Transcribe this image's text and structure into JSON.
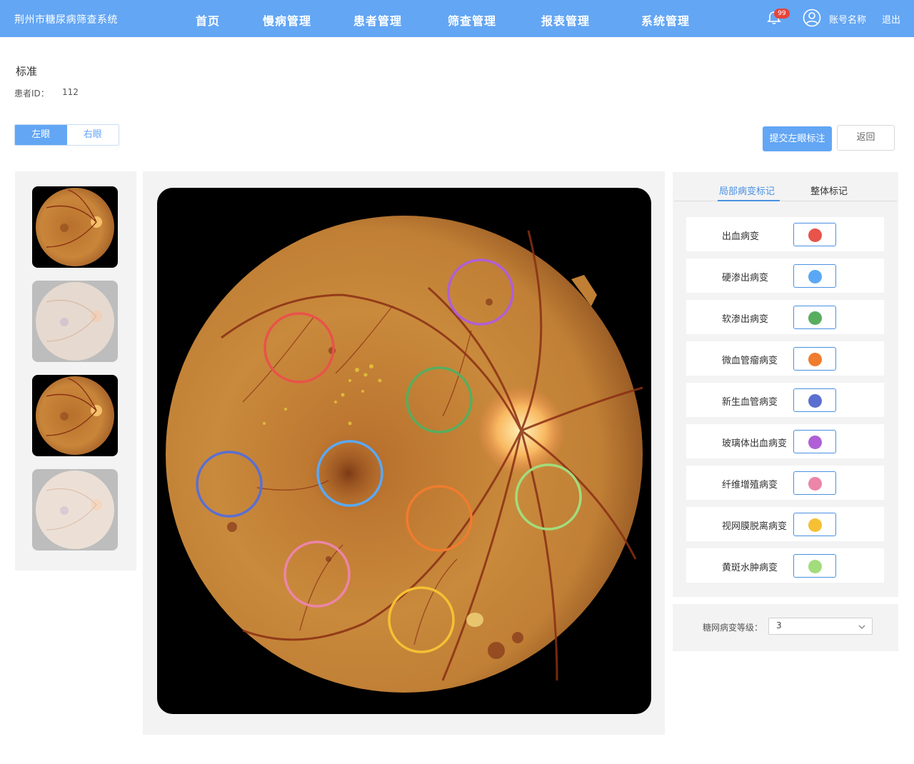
{
  "header": {
    "brand": "荆州市糖尿病筛查系统",
    "nav": [
      "首页",
      "慢病管理",
      "患者管理",
      "筛查管理",
      "报表管理",
      "系统管理"
    ],
    "badge": "99",
    "account": "账号名称",
    "logout": "退出"
  },
  "info": {
    "title": "标准",
    "patient_label": "患者ID：",
    "patient_id": "112"
  },
  "eye_tabs": {
    "left": "左眼",
    "right": "右眼"
  },
  "actions": {
    "submit": "提交左眼标注",
    "back": "返回"
  },
  "lesion_panel": {
    "tabs": [
      "局部病变标记",
      "整体标记"
    ],
    "items": [
      {
        "label": "出血病变",
        "color": "#e8534a"
      },
      {
        "label": "硬渗出病变",
        "color": "#5aa8f5"
      },
      {
        "label": "软渗出病变",
        "color": "#58ad5e"
      },
      {
        "label": "微血管瘤病变",
        "color": "#f07c2e"
      },
      {
        "label": "新生血管病变",
        "color": "#5b6fd1"
      },
      {
        "label": "玻璃体出血病变",
        "color": "#b05fd6"
      },
      {
        "label": "纤维增殖病变",
        "color": "#ec85a8"
      },
      {
        "label": "视网膜脱离病变",
        "color": "#f6c034"
      },
      {
        "label": "黄斑水肿病变",
        "color": "#a2dc7c"
      }
    ]
  },
  "grade": {
    "label": "糖网病变等级：",
    "value": "3"
  },
  "colors": {
    "primary": "#63a6f4",
    "accent": "#4a90e2"
  }
}
